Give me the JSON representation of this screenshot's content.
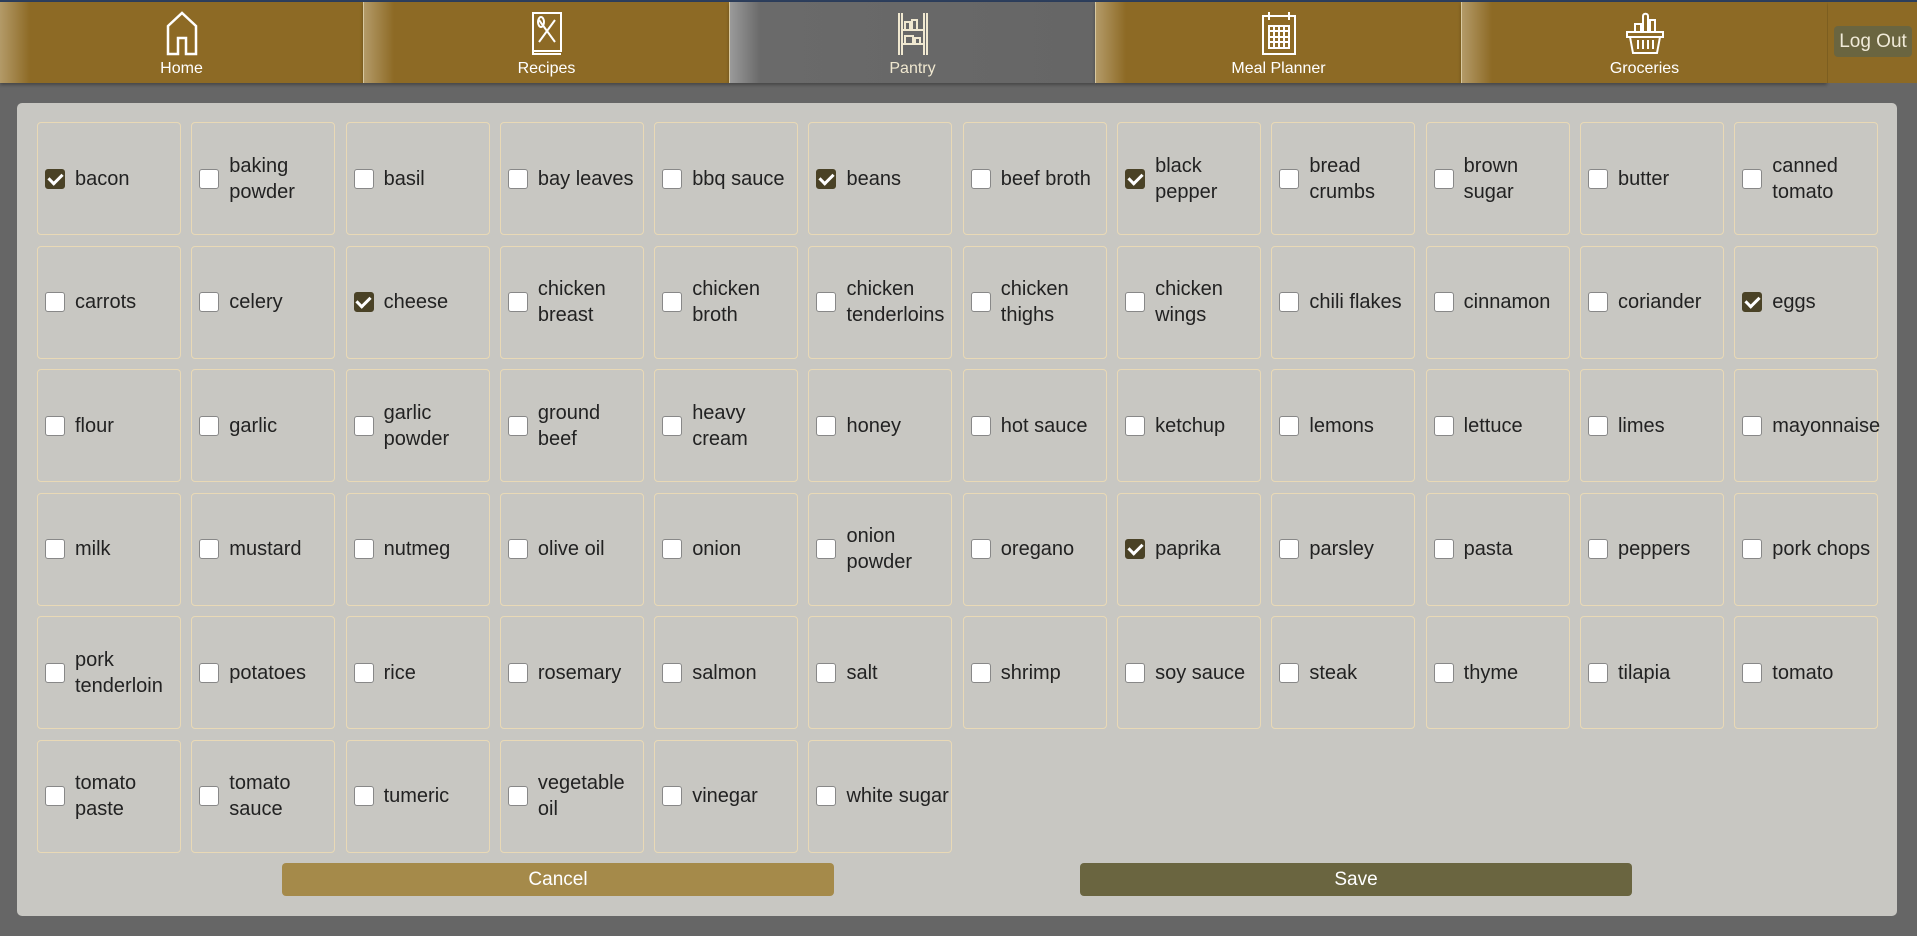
{
  "nav": {
    "tabs": [
      {
        "label": "Home",
        "icon": "home-icon",
        "active": false
      },
      {
        "label": "Recipes",
        "icon": "recipe-book-icon",
        "active": false
      },
      {
        "label": "Pantry",
        "icon": "pantry-shelf-icon",
        "active": true
      },
      {
        "label": "Meal Planner",
        "icon": "calendar-icon",
        "active": false
      },
      {
        "label": "Groceries",
        "icon": "grocery-basket-icon",
        "active": false
      }
    ],
    "logout_label": "Log Out"
  },
  "pantry": {
    "items": [
      {
        "label": "bacon",
        "checked": true
      },
      {
        "label": "baking powder",
        "checked": false
      },
      {
        "label": "basil",
        "checked": false
      },
      {
        "label": "bay leaves",
        "checked": false
      },
      {
        "label": "bbq sauce",
        "checked": false
      },
      {
        "label": "beans",
        "checked": true
      },
      {
        "label": "beef broth",
        "checked": false
      },
      {
        "label": "black pepper",
        "checked": true
      },
      {
        "label": "bread crumbs",
        "checked": false
      },
      {
        "label": "brown sugar",
        "checked": false
      },
      {
        "label": "butter",
        "checked": false
      },
      {
        "label": "canned tomato",
        "checked": false
      },
      {
        "label": "carrots",
        "checked": false
      },
      {
        "label": "celery",
        "checked": false
      },
      {
        "label": "cheese",
        "checked": true
      },
      {
        "label": "chicken breast",
        "checked": false
      },
      {
        "label": "chicken broth",
        "checked": false
      },
      {
        "label": "chicken tenderloins",
        "checked": false
      },
      {
        "label": "chicken thighs",
        "checked": false
      },
      {
        "label": "chicken wings",
        "checked": false
      },
      {
        "label": "chili flakes",
        "checked": false
      },
      {
        "label": "cinnamon",
        "checked": false
      },
      {
        "label": "coriander",
        "checked": false
      },
      {
        "label": "eggs",
        "checked": true
      },
      {
        "label": "flour",
        "checked": false
      },
      {
        "label": "garlic",
        "checked": false
      },
      {
        "label": "garlic powder",
        "checked": false
      },
      {
        "label": "ground beef",
        "checked": false
      },
      {
        "label": "heavy cream",
        "checked": false
      },
      {
        "label": "honey",
        "checked": false
      },
      {
        "label": "hot sauce",
        "checked": false
      },
      {
        "label": "ketchup",
        "checked": false
      },
      {
        "label": "lemons",
        "checked": false
      },
      {
        "label": "lettuce",
        "checked": false
      },
      {
        "label": "limes",
        "checked": false
      },
      {
        "label": "mayonnaise",
        "checked": false
      },
      {
        "label": "milk",
        "checked": false
      },
      {
        "label": "mustard",
        "checked": false
      },
      {
        "label": "nutmeg",
        "checked": false
      },
      {
        "label": "olive oil",
        "checked": false
      },
      {
        "label": "onion",
        "checked": false
      },
      {
        "label": "onion powder",
        "checked": false
      },
      {
        "label": "oregano",
        "checked": false
      },
      {
        "label": "paprika",
        "checked": true
      },
      {
        "label": "parsley",
        "checked": false
      },
      {
        "label": "pasta",
        "checked": false
      },
      {
        "label": "peppers",
        "checked": false
      },
      {
        "label": "pork chops",
        "checked": false
      },
      {
        "label": "pork tenderloin",
        "checked": false
      },
      {
        "label": "potatoes",
        "checked": false
      },
      {
        "label": "rice",
        "checked": false
      },
      {
        "label": "rosemary",
        "checked": false
      },
      {
        "label": "salmon",
        "checked": false
      },
      {
        "label": "salt",
        "checked": false
      },
      {
        "label": "shrimp",
        "checked": false
      },
      {
        "label": "soy sauce",
        "checked": false
      },
      {
        "label": "steak",
        "checked": false
      },
      {
        "label": "thyme",
        "checked": false
      },
      {
        "label": "tilapia",
        "checked": false
      },
      {
        "label": "tomato",
        "checked": false
      },
      {
        "label": "tomato paste",
        "checked": false
      },
      {
        "label": "tomato sauce",
        "checked": false
      },
      {
        "label": "tumeric",
        "checked": false
      },
      {
        "label": "vegetable oil",
        "checked": false
      },
      {
        "label": "vinegar",
        "checked": false
      },
      {
        "label": "white sugar",
        "checked": false
      }
    ],
    "cancel_label": "Cancel",
    "save_label": "Save"
  }
}
